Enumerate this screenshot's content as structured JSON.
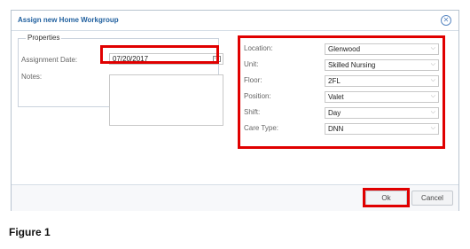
{
  "dialog": {
    "title": "Assign new Home Workgroup",
    "close_icon": "circle-x-icon"
  },
  "properties": {
    "legend": "Properties",
    "assignment_date_label": "Assignment Date:",
    "assignment_date_value": "07/20/2017",
    "calendar_icon": "calendar-icon",
    "notes_label": "Notes:",
    "notes_value": ""
  },
  "fields": [
    {
      "label": "Location:",
      "value": "Glenwood"
    },
    {
      "label": "Unit:",
      "value": "Skilled Nursing"
    },
    {
      "label": "Floor:",
      "value": "2FL"
    },
    {
      "label": "Position:",
      "value": "Valet"
    },
    {
      "label": "Shift:",
      "value": "Day"
    },
    {
      "label": "Care Type:",
      "value": "DNN"
    }
  ],
  "footer": {
    "ok_label": "Ok",
    "cancel_label": "Cancel"
  },
  "caption": "Figure 1",
  "colors": {
    "highlight": "#e00000",
    "title": "#1f5f9e"
  }
}
